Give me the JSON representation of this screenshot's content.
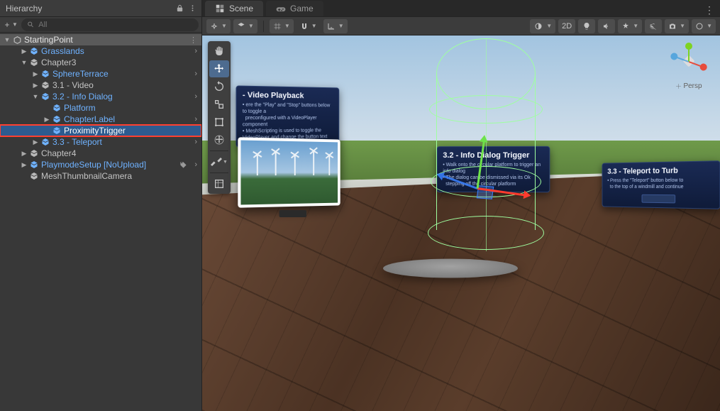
{
  "hierarchy": {
    "title": "Hierarchy",
    "search_placeholder": "All",
    "scene_name": "StartingPoint",
    "items": {
      "grasslands": "Grasslands",
      "chapter3": "Chapter3",
      "sphereterrace": "SphereTerrace",
      "sec31": "3.1 - Video",
      "sec32": "3.2 - Info Dialog",
      "platform": "Platform",
      "chapterlabel": "ChapterLabel",
      "proximitytrigger": "ProximityTrigger",
      "sec33": "3.3 - Teleport",
      "chapter4": "Chapter4",
      "playmode": "PlaymodeSetup [NoUpload]",
      "meshthumb": "MeshThumbnailCamera"
    }
  },
  "tabs": {
    "scene": "Scene",
    "game": "Game"
  },
  "scene_toolbar": {
    "mode_2d": "2D"
  },
  "orientation": {
    "persp": "Persp"
  },
  "panels": {
    "p31": {
      "title": "- Video Playback",
      "body1": "ere the \"Play\" and \"Stop\" buttons below to toggle a",
      "body2": "preconfigured with a VideoPlayer component",
      "body3": "MeshScripting is used to toggle the VideoPlayer and change the button text"
    },
    "p32": {
      "title": "3.2 - Info Dialog Trigger",
      "body1": "Walk onto the circular platform to trigger an info dialog",
      "body2": "The dialog can be dismissed via its Ok",
      "body3": "stepping off the circular platform"
    },
    "p33": {
      "title": "3.3 - Teleport to Turb",
      "body1": "Press the \"Teleport\" button below to",
      "body2": "to the top of a windmill and continue"
    }
  }
}
